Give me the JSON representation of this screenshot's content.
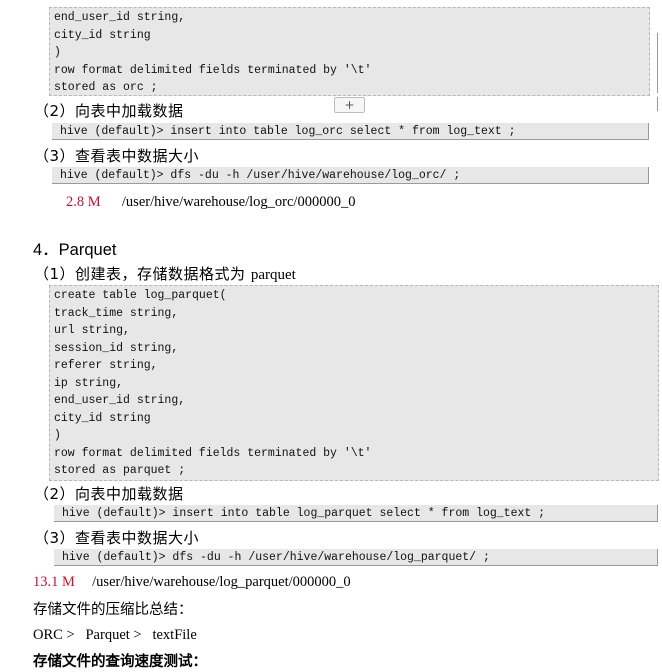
{
  "orc_code_tail": [
    "end_user_id string,",
    "city_id string",
    ")",
    "row format delimited fields terminated by '\\t'",
    "stored as orc ;"
  ],
  "orc_steps": {
    "load_label": "（2）向表中加载数据",
    "load_cmd": "hive (default)> insert into table log_orc select * from log_text ;",
    "size_label": "（3）查看表中数据大小",
    "size_cmd": "hive (default)> dfs -du -h /user/hive/warehouse/log_orc/ ;",
    "result_size": "2.8 M",
    "result_path": "/user/hive/warehouse/log_orc/000000_0"
  },
  "parquet_section": {
    "heading": "4．Parquet",
    "create_label_prefix": "（1）创建表，存储数据格式为 ",
    "create_label_format": "parquet",
    "code": [
      "create table log_parquet(",
      "track_time string,",
      "url string,",
      "session_id string,",
      "referer string,",
      "ip string,",
      "end_user_id string,",
      "city_id string",
      ")",
      "row format delimited fields terminated by '\\t'",
      "stored as parquet ;"
    ],
    "load_label": "（2）向表中加载数据",
    "load_cmd": "hive (default)> insert into table log_parquet select * from log_text ;",
    "size_label": "（3）查看表中数据大小",
    "size_cmd": "hive (default)> dfs -du -h /user/hive/warehouse/log_parquet/ ;",
    "result_size": "13.1 M",
    "result_path": "/user/hive/warehouse/log_parquet/000000_0"
  },
  "summary": {
    "compression_title": "存储文件的压缩比总结：",
    "compression_ranking": "ORC >   Parquet >   textFile",
    "query_title": "存储文件的查询速度测试："
  },
  "toolbar": {
    "add_button": "+"
  }
}
